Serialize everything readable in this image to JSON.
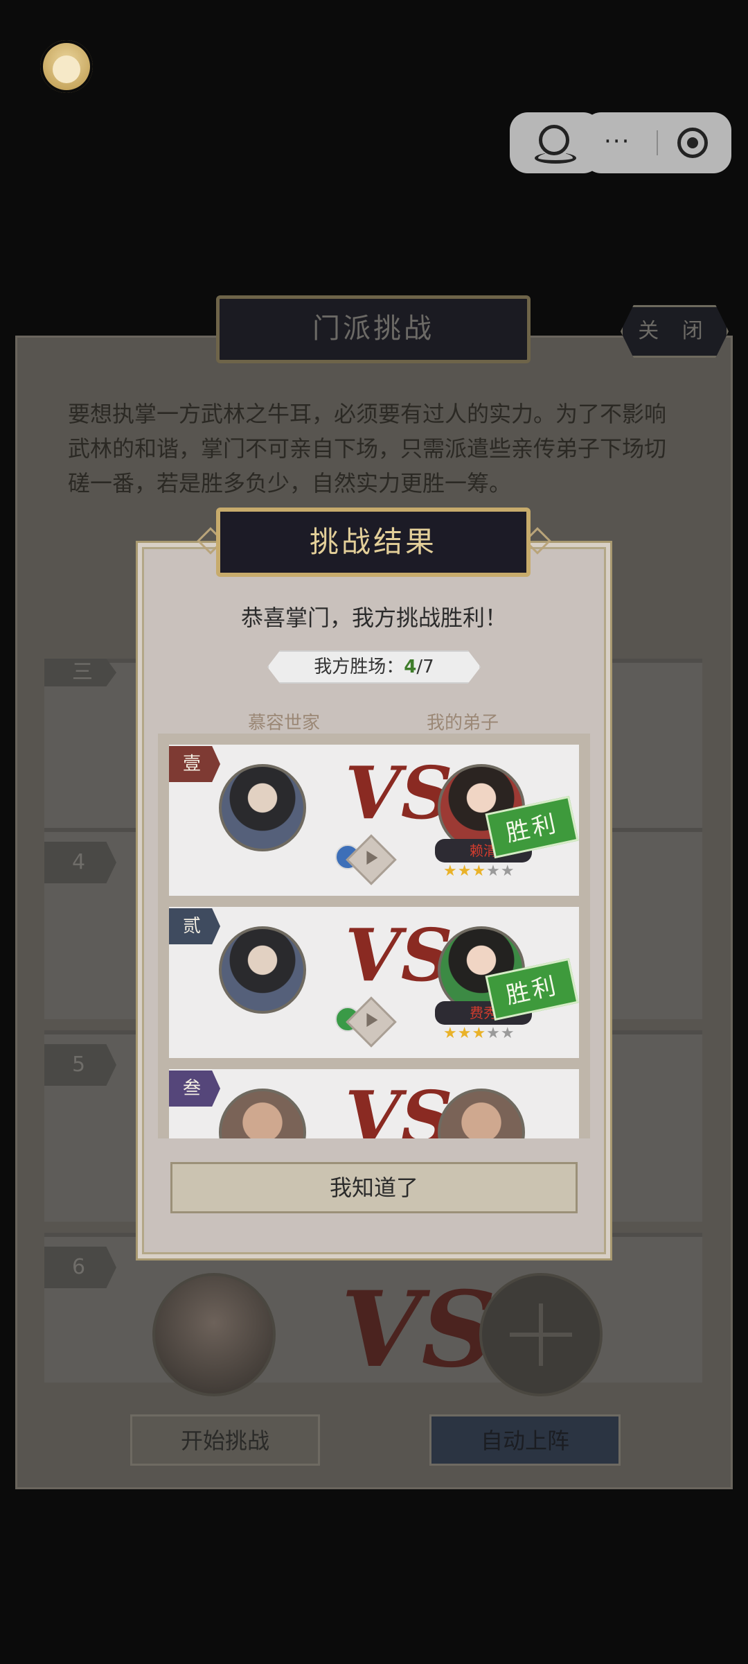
{
  "colors": {
    "victory_green": "#3f7d2b",
    "accent_gold": "#c7ab6c",
    "vs_red": "#8a2a22",
    "auto_button": "#2b3442"
  },
  "top": {
    "avatar_icon": "bun-avatar-icon",
    "miniprogram_icon": "person-icon",
    "more_label": "···",
    "record_icon": "target-icon"
  },
  "background_panel": {
    "title": "门派挑战",
    "close_label": "关 闭",
    "description": "要想执掌一方武林之牛耳，必须要有过人的实力。为了不影响武林的和谐，掌门不可亲自下场，只需派遣些亲传弟子下场切磋一番，若是胜多负少，自然实力更胜一筹。",
    "rows": [
      {
        "tag": "三"
      },
      {
        "tag": "4"
      },
      {
        "tag": "5"
      },
      {
        "tag": "6"
      }
    ],
    "vs_label": "VS",
    "start_button": "开始挑战",
    "auto_button": "自动上阵"
  },
  "dialog": {
    "title": "挑战结果",
    "congrats": "恭喜掌门，我方挑战胜利！",
    "wins": {
      "label": "我方胜场：",
      "won": "4",
      "total": "/7"
    },
    "col_opponent": "慕容世家",
    "col_mine": "我的弟子",
    "matches": [
      {
        "rank": "壹",
        "rank_color": "#7e3a33",
        "vs": "VS",
        "my_name": "赖清",
        "stars_on": "★★★",
        "stars_off": "★★",
        "stars": 3,
        "result": "胜利"
      },
      {
        "rank": "贰",
        "rank_color": "#3f4b5f",
        "vs": "VS",
        "my_name": "费秀",
        "stars_on": "★★★",
        "stars_off": "★★",
        "stars": 3,
        "result": "胜利"
      },
      {
        "rank": "叁",
        "rank_color": "#55467a",
        "vs": "VS"
      }
    ],
    "ok_button": "我知道了"
  }
}
